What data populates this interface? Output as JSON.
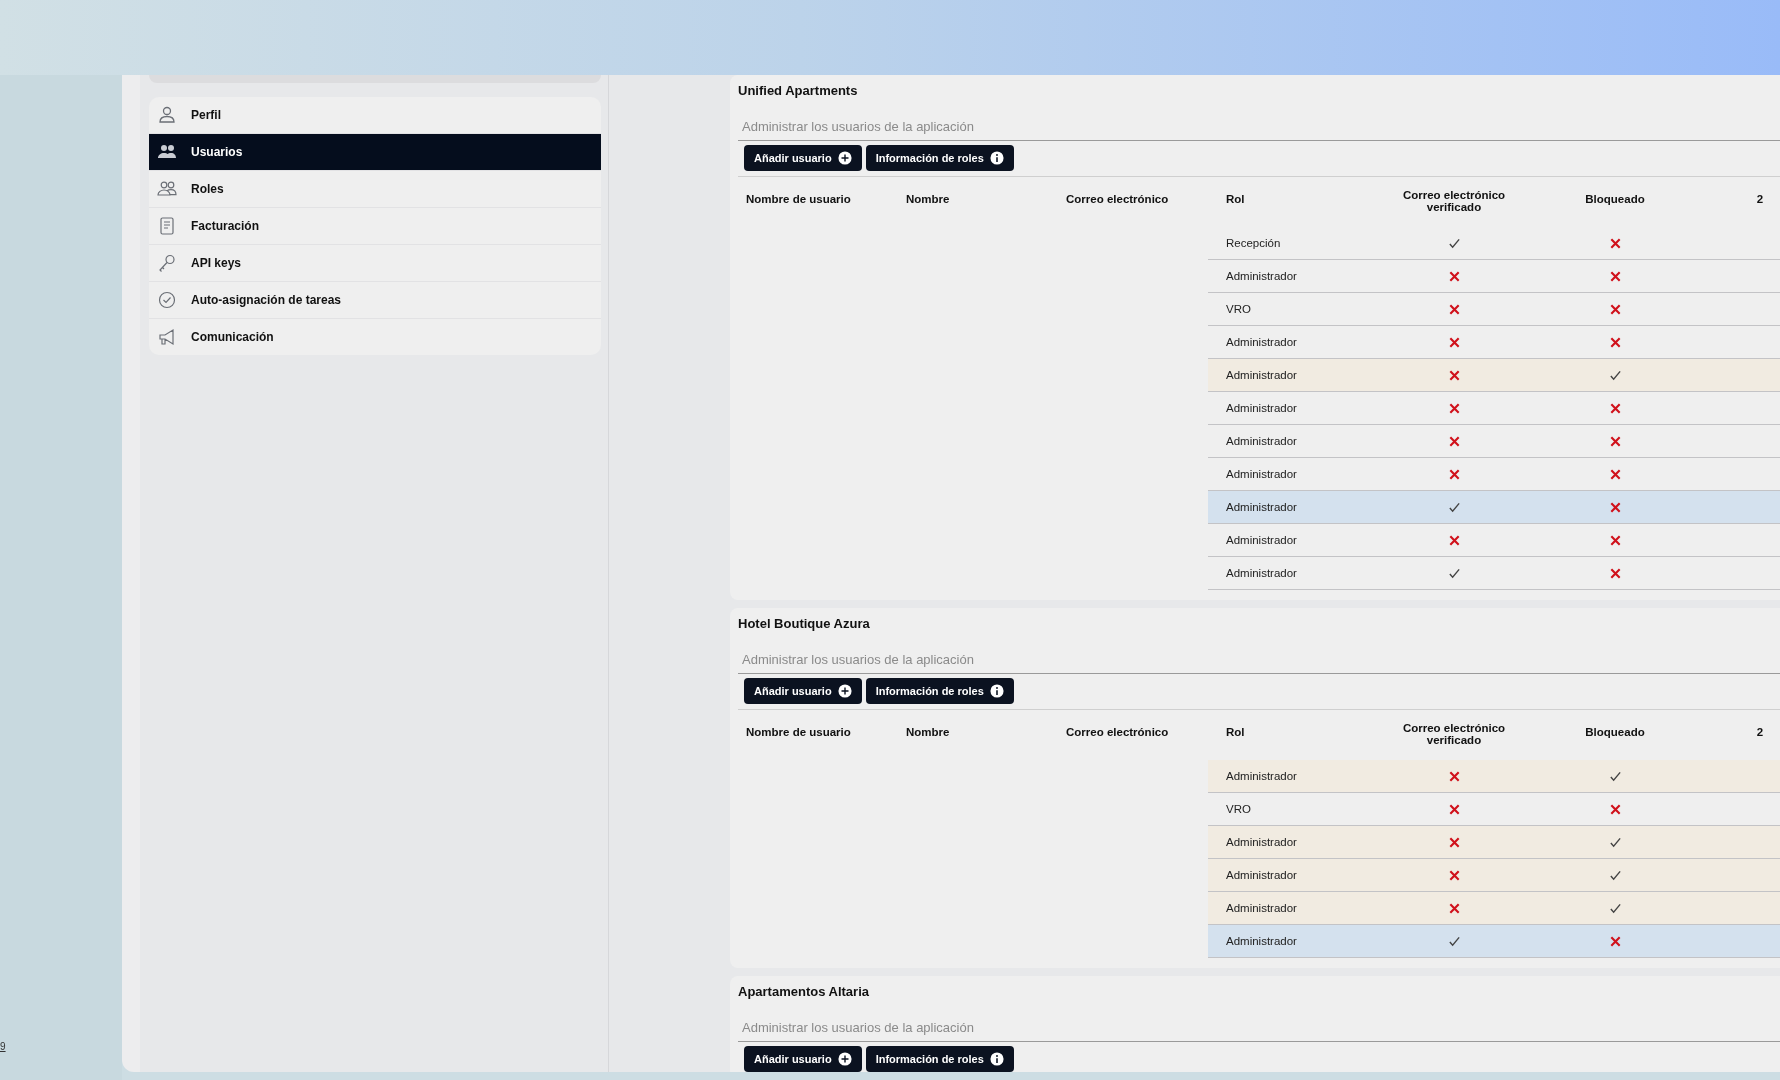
{
  "sidebar": {
    "menu": [
      {
        "label": "Perfil",
        "selected": false
      },
      {
        "label": "Usuarios",
        "selected": true
      },
      {
        "label": "Roles",
        "selected": false
      },
      {
        "label": "Facturación",
        "selected": false
      },
      {
        "label": "API keys",
        "selected": false
      },
      {
        "label": "Auto-asignación de tareas",
        "selected": false
      },
      {
        "label": "Comunicación",
        "selected": false
      }
    ]
  },
  "corner_text": "9",
  "sections": [
    {
      "title": "Unified Apartments",
      "subtitle": "Administrar los usuarios de la aplicación",
      "buttons": [
        {
          "label": "Añadir usuario",
          "kind": "add"
        },
        {
          "label": "Información de roles",
          "kind": "info"
        }
      ],
      "table": {
        "columns": [
          "Nombre de usuario",
          "Nombre",
          "Correo electrónico",
          "Rol",
          "Correo electrónico verificado",
          "Bloqueado",
          "2"
        ],
        "rows": [
          {
            "rol": "Recepción",
            "email_verified": true,
            "blocked": false,
            "kind": "plain"
          },
          {
            "rol": "Administrador",
            "email_verified": false,
            "blocked": false,
            "kind": "plain"
          },
          {
            "rol": "VRO",
            "email_verified": false,
            "blocked": false,
            "kind": "plain"
          },
          {
            "rol": "Administrador",
            "email_verified": false,
            "blocked": false,
            "kind": "plain"
          },
          {
            "rol": "Administrador",
            "email_verified": false,
            "blocked": true,
            "kind": "warning"
          },
          {
            "rol": "Administrador",
            "email_verified": false,
            "blocked": false,
            "kind": "plain"
          },
          {
            "rol": "Administrador",
            "email_verified": false,
            "blocked": false,
            "kind": "plain"
          },
          {
            "rol": "Administrador",
            "email_verified": false,
            "blocked": false,
            "kind": "plain"
          },
          {
            "rol": "Administrador",
            "email_verified": true,
            "blocked": false,
            "kind": "highlighted"
          },
          {
            "rol": "Administrador",
            "email_verified": false,
            "blocked": false,
            "kind": "plain"
          },
          {
            "rol": "Administrador",
            "email_verified": true,
            "blocked": false,
            "kind": "plain"
          }
        ]
      }
    },
    {
      "title": "Hotel Boutique Azura",
      "subtitle": "Administrar los usuarios de la aplicación",
      "buttons": [
        {
          "label": "Añadir usuario",
          "kind": "add"
        },
        {
          "label": "Información de roles",
          "kind": "info"
        }
      ],
      "table": {
        "columns": [
          "Nombre de usuario",
          "Nombre",
          "Correo electrónico",
          "Rol",
          "Correo electrónico verificado",
          "Bloqueado",
          "2"
        ],
        "rows": [
          {
            "rol": "Administrador",
            "email_verified": false,
            "blocked": true,
            "kind": "warning"
          },
          {
            "rol": "VRO",
            "email_verified": false,
            "blocked": false,
            "kind": "plain"
          },
          {
            "rol": "Administrador",
            "email_verified": false,
            "blocked": true,
            "kind": "warning"
          },
          {
            "rol": "Administrador",
            "email_verified": false,
            "blocked": true,
            "kind": "warning"
          },
          {
            "rol": "Administrador",
            "email_verified": false,
            "blocked": true,
            "kind": "warning"
          },
          {
            "rol": "Administrador",
            "email_verified": true,
            "blocked": false,
            "kind": "highlighted"
          }
        ]
      }
    },
    {
      "title": "Apartamentos Altaria",
      "subtitle": "Administrar los usuarios de la aplicación",
      "buttons": [
        {
          "label": "Añadir usuario",
          "kind": "add"
        },
        {
          "label": "Información de roles",
          "kind": "info"
        }
      ]
    }
  ]
}
